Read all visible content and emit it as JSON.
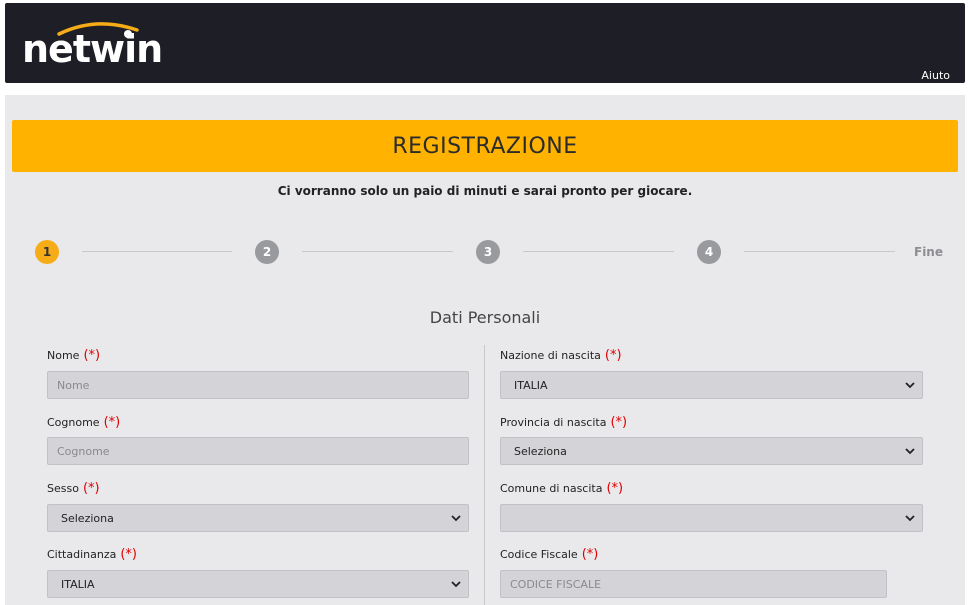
{
  "header": {
    "logo_text": "Netwin",
    "help_label": "Aiuto",
    "colors": {
      "background": "#1e1f26",
      "accent": "#f6ac17"
    }
  },
  "registration": {
    "title": "REGISTRAZIONE",
    "subtitle": "Ci vorranno solo un paio di minuti e sarai pronto per giocare.",
    "steps": [
      {
        "label": "1",
        "state": "active"
      },
      {
        "label": "2",
        "state": "inactive"
      },
      {
        "label": "3",
        "state": "inactive"
      },
      {
        "label": "4",
        "state": "inactive"
      }
    ],
    "final_step_label": "Fine",
    "section_title": "Dati Personali",
    "required_marker": "(*)",
    "left_fields": [
      {
        "label": "Nome",
        "type": "input",
        "placeholder": "Nome",
        "value": ""
      },
      {
        "label": "Cognome",
        "type": "input",
        "placeholder": "Cognome",
        "value": ""
      },
      {
        "label": "Sesso",
        "type": "select",
        "value": "Seleziona"
      },
      {
        "label": "Cittadinanza",
        "type": "select",
        "value": "ITALIA"
      }
    ],
    "right_fields": [
      {
        "label": "Nazione di nascita",
        "type": "select",
        "value": "ITALIA"
      },
      {
        "label": "Provincia di nascita",
        "type": "select",
        "value": "Seleziona"
      },
      {
        "label": "Comune di nascita",
        "type": "select",
        "value": ""
      },
      {
        "label": "Codice Fiscale",
        "type": "input",
        "placeholder": "CODICE FISCALE",
        "value": ""
      }
    ],
    "colors": {
      "title_bar": "#ffb300",
      "required": "#e00000",
      "step_active": "#f6ac17",
      "step_inactive": "#999a9e"
    }
  }
}
